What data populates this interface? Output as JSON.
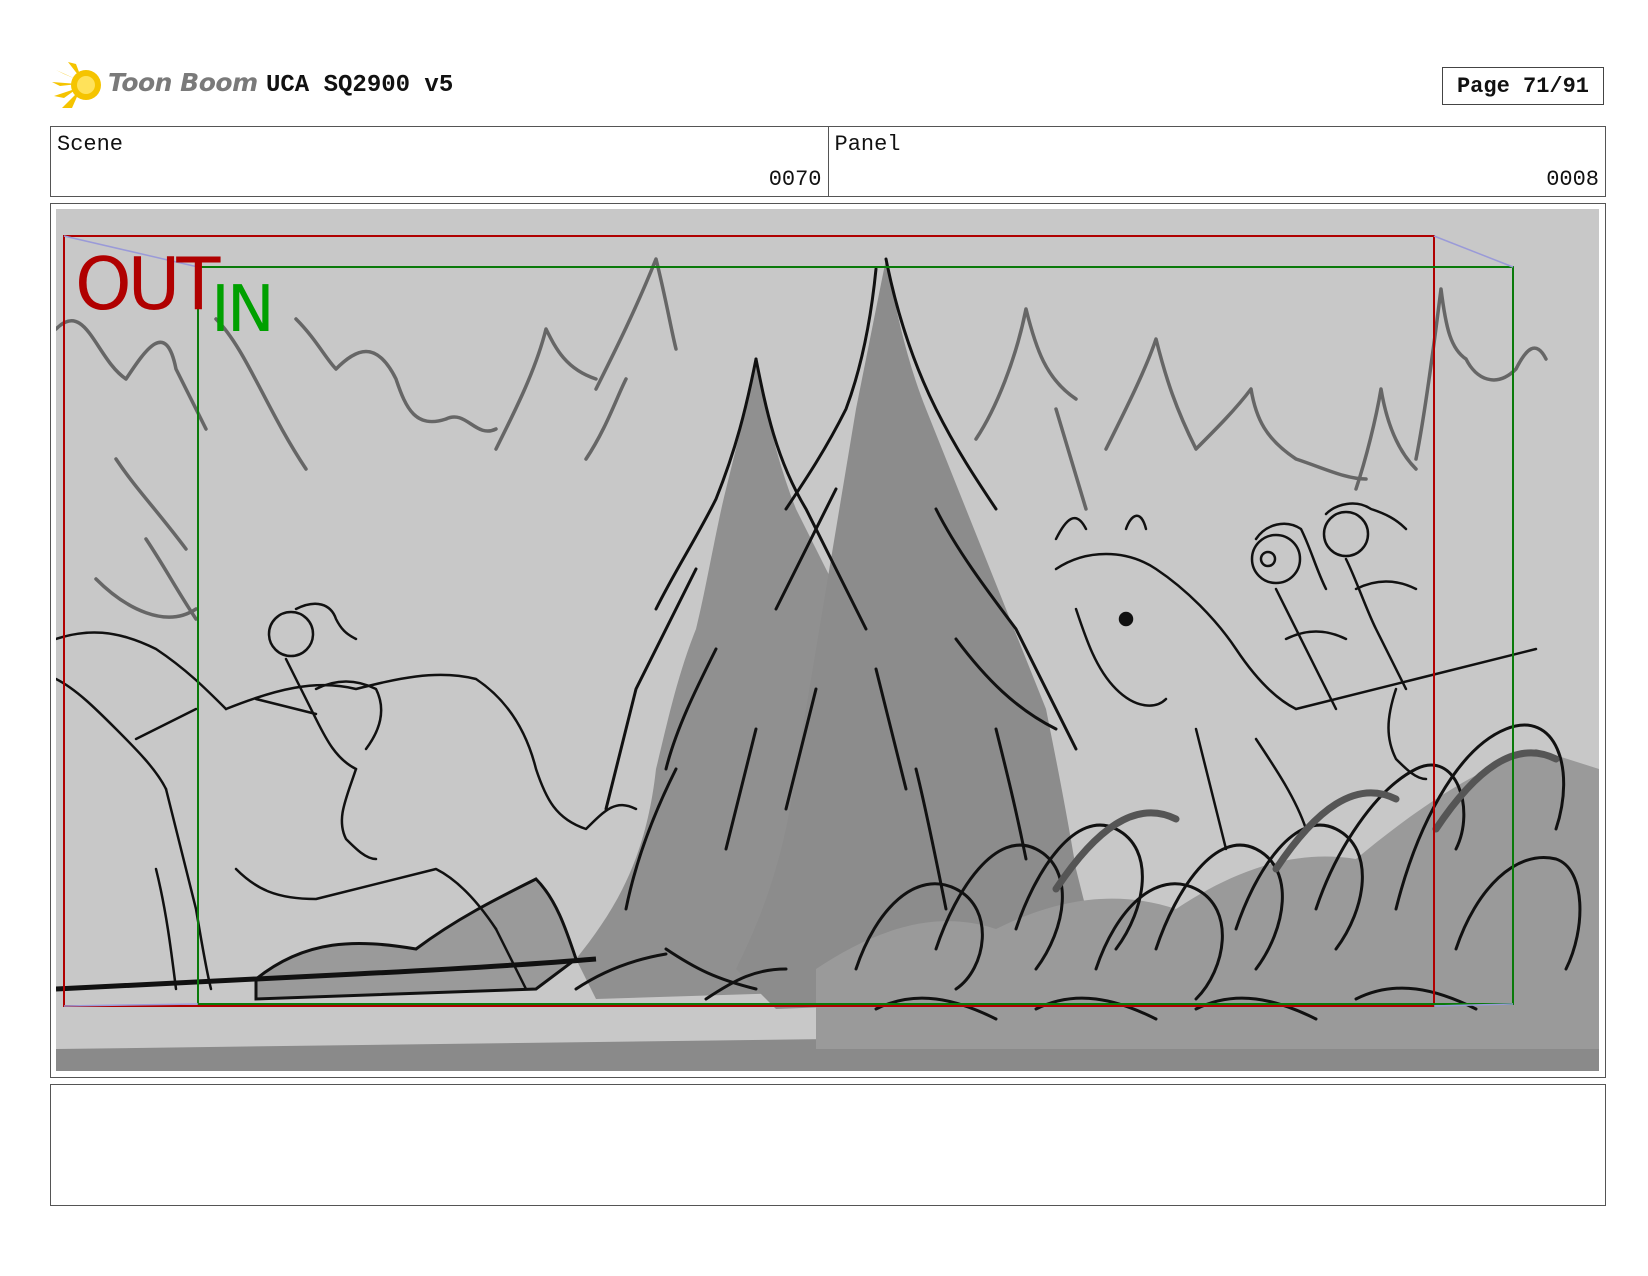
{
  "header": {
    "brand": "Toon Boom",
    "title": "UCA SQ2900 v5",
    "page_label": "Page 71/91",
    "brand_color": "#f5c400"
  },
  "info": {
    "scene_label": "Scene",
    "scene_value": "0070",
    "panel_label": "Panel",
    "panel_value": "0008"
  },
  "panel": {
    "out_label": "OUT",
    "in_label": "IN",
    "out_color": "#b00000",
    "in_color": "#00a000"
  },
  "notes": {
    "text": ""
  }
}
